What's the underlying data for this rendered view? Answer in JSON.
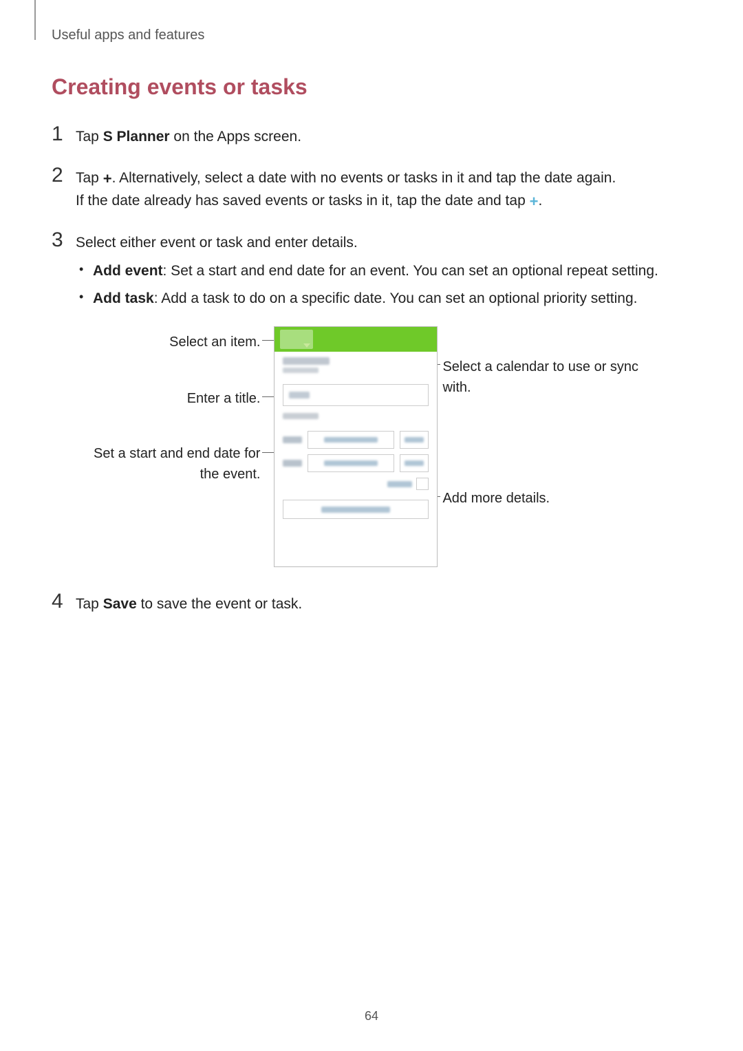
{
  "header": {
    "breadcrumb": "Useful apps and features"
  },
  "section": {
    "title": "Creating events or tasks"
  },
  "steps": [
    {
      "number": "1",
      "text_prefix": "Tap ",
      "bold1": "S Planner",
      "text_suffix": " on the Apps screen."
    },
    {
      "number": "2",
      "text_prefix": "Tap ",
      "text_mid": ". Alternatively, select a date with no events or tasks in it and tap the date again.",
      "text_line2_prefix": "If the date already has saved events or tasks in it, tap the date and tap ",
      "text_line2_suffix": "."
    },
    {
      "number": "3",
      "text": "Select either event or task and enter details.",
      "bullets": [
        {
          "bold": "Add event",
          "text": ": Set a start and end date for an event. You can set an optional repeat setting."
        },
        {
          "bold": "Add task",
          "text": ": Add a task to do on a specific date. You can set an optional priority setting."
        }
      ]
    },
    {
      "number": "4",
      "text_prefix": "Tap ",
      "bold1": "Save",
      "text_suffix": " to save the event or task."
    }
  ],
  "callouts": {
    "select_item": "Select an item.",
    "enter_title": "Enter a title.",
    "set_dates": "Set a start and end date for the event.",
    "select_calendar": "Select a calendar to use or sync with.",
    "add_details": "Add more details."
  },
  "page_number": "64"
}
